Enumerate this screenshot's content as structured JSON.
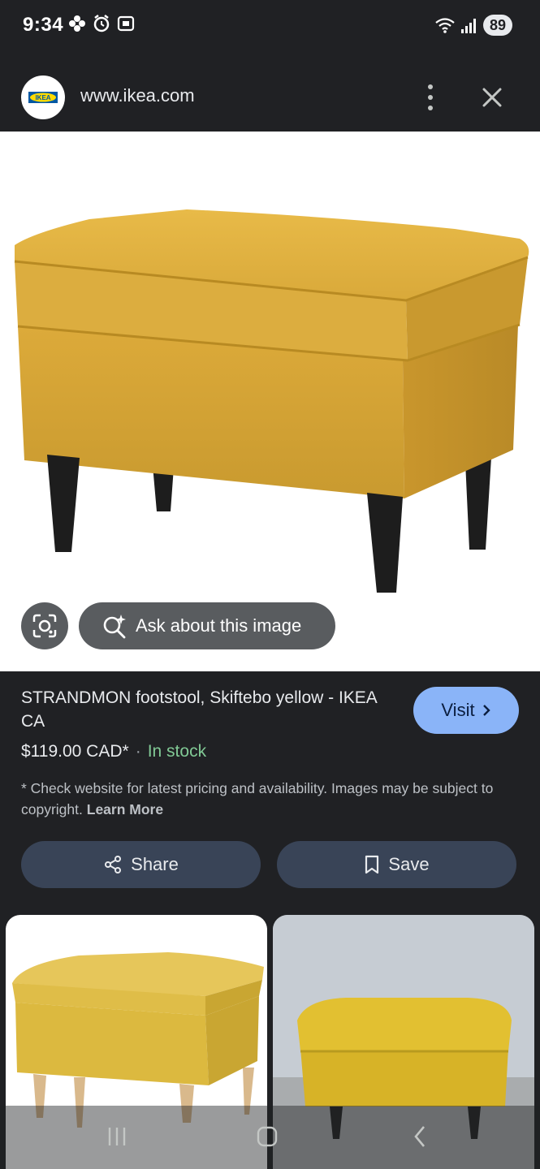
{
  "status_bar": {
    "time": "9:34",
    "battery": "89",
    "icons_left": [
      "pinwheel-icon",
      "alarm-icon",
      "screenshot-icon"
    ],
    "icons_right": [
      "wifi-icon",
      "signal-icon"
    ]
  },
  "browser": {
    "url": "www.ikea.com",
    "logo_text": "IKEA"
  },
  "image_actions": {
    "ask_label": "Ask about this image"
  },
  "product": {
    "title": "STRANDMON footstool, Skiftebo yellow - IKEA CA",
    "visit_label": "Visit",
    "price": "$119.00 CAD*",
    "separator": "·",
    "stock": "In stock",
    "disclaimer": "* Check website for latest pricing and availability. Images may be subject to copyright.",
    "learn_more": "Learn More",
    "share_label": "Share",
    "save_label": "Save"
  },
  "colors": {
    "background": "#202124",
    "accent": "#8ab4f8",
    "stock_green": "#81c995",
    "ottoman_yellow": "#d9a93a"
  }
}
